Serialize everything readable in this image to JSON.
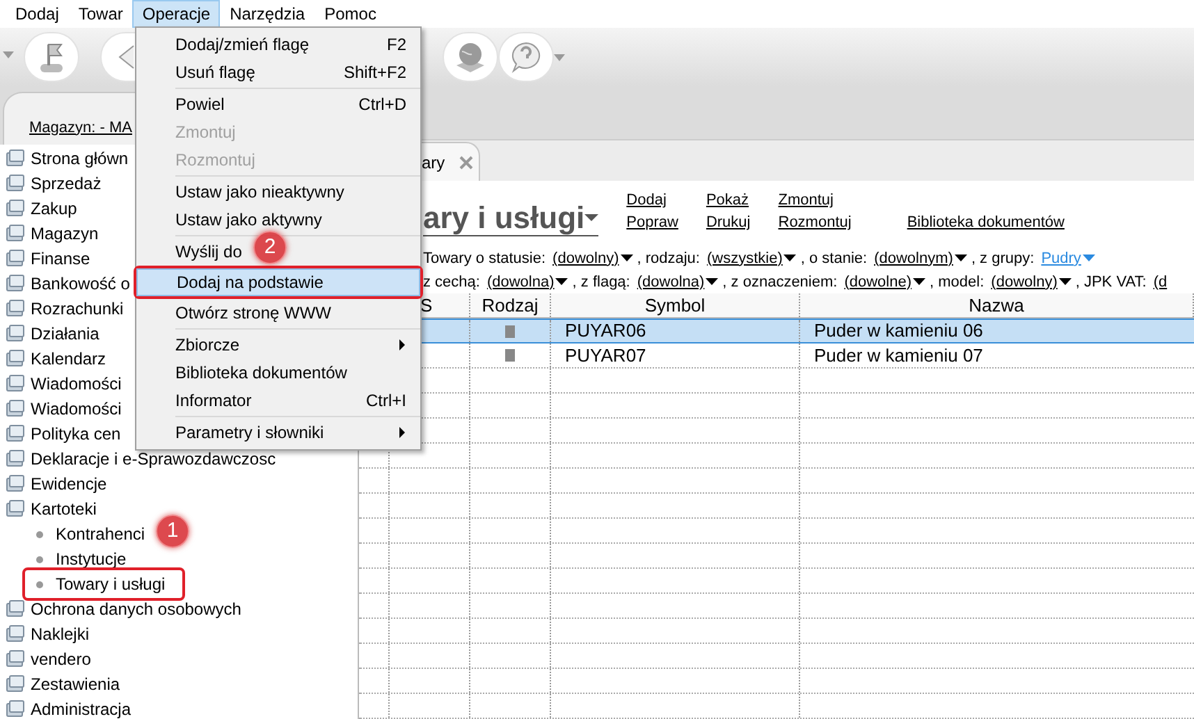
{
  "menu_bar": [
    {
      "label": "Dodaj",
      "selected": false
    },
    {
      "label": "Towar",
      "selected": false
    },
    {
      "label": "Operacje",
      "selected": true
    },
    {
      "label": "Narzędzia",
      "selected": false
    },
    {
      "label": "Pomoc",
      "selected": false
    }
  ],
  "dropdown_menu": [
    {
      "label": "Dodaj/zmień flagę",
      "shortcut": "F2",
      "disabled": false,
      "separator_after": false
    },
    {
      "label": "Usuń flagę",
      "shortcut": "Shift+F2",
      "disabled": false,
      "separator_after": true
    },
    {
      "label": "Powiel",
      "shortcut": "Ctrl+D",
      "disabled": false,
      "separator_after": false
    },
    {
      "label": "Zmontuj",
      "disabled": true,
      "separator_after": false
    },
    {
      "label": "Rozmontuj",
      "disabled": true,
      "separator_after": true
    },
    {
      "label": "Ustaw jako nieaktywny",
      "disabled": false,
      "separator_after": false
    },
    {
      "label": "Ustaw jako aktywny",
      "disabled": false,
      "separator_after": true
    },
    {
      "label": "Wyślij do",
      "disabled": false,
      "separator_after": false
    },
    {
      "label": "Dodaj na podstawie",
      "disabled": false,
      "selected": true,
      "highlighted": true,
      "separator_after": false
    },
    {
      "label": "Otwórz stronę WWW",
      "disabled": false,
      "separator_after": true
    },
    {
      "label": "Zbiorcze",
      "disabled": false,
      "submenu": true,
      "separator_after": false
    },
    {
      "label": "Biblioteka dokumentów",
      "disabled": false,
      "separator_after": false
    },
    {
      "label": "Informator",
      "shortcut": "Ctrl+I",
      "disabled": false,
      "separator_after": true
    },
    {
      "label": "Parametry i słowniki",
      "disabled": false,
      "submenu": true,
      "separator_after": false
    }
  ],
  "sidebar": {
    "header": "Magazyn: - MA",
    "items": [
      {
        "label": "Strona główn"
      },
      {
        "label": "Sprzedaż"
      },
      {
        "label": "Zakup"
      },
      {
        "label": "Magazyn"
      },
      {
        "label": "Finanse"
      },
      {
        "label": "Bankowość o"
      },
      {
        "label": "Rozrachunki"
      },
      {
        "label": "Działania"
      },
      {
        "label": "Kalendarz"
      },
      {
        "label": "Wiadomości"
      },
      {
        "label": "Wiadomości"
      },
      {
        "label": "Polityka cen"
      },
      {
        "label": "Deklaracje i e-Sprawozdawczosc"
      },
      {
        "label": "Ewidencje"
      },
      {
        "label": "Kartoteki",
        "children": [
          {
            "label": "Kontrahenci",
            "highlighted": false
          },
          {
            "label": "Instytucje",
            "highlighted": false
          },
          {
            "label": "Towary i usługi",
            "highlighted": true
          }
        ]
      },
      {
        "label": "Ochrona danych osobowych"
      },
      {
        "label": "Naklejki"
      },
      {
        "label": "vendero"
      },
      {
        "label": "Zestawienia"
      },
      {
        "label": "Administracja"
      }
    ]
  },
  "tab": {
    "label": "ary"
  },
  "page": {
    "title": "ary i usługi",
    "link_columns": [
      [
        "Dodaj",
        "Popraw"
      ],
      [
        "Pokaż",
        "Drukuj"
      ],
      [
        "Zmontuj",
        "Rozmontuj"
      ],
      [
        "",
        "Biblioteka dokumentów"
      ]
    ],
    "filter_rows": [
      [
        {
          "kind": "label",
          "text": "Towary o statusie:"
        },
        {
          "kind": "dropdown",
          "text": "(dowolny)",
          "active": false
        },
        {
          "kind": "label",
          "text": ", rodzaju:"
        },
        {
          "kind": "dropdown",
          "text": "(wszystkie)",
          "active": false
        },
        {
          "kind": "label",
          "text": ", o stanie:"
        },
        {
          "kind": "dropdown",
          "text": "(dowolnym)",
          "active": false
        },
        {
          "kind": "label",
          "text": ", z grupy:"
        },
        {
          "kind": "dropdown",
          "text": "Pudry",
          "active": true
        }
      ],
      [
        {
          "kind": "label",
          "text": "z cechą:"
        },
        {
          "kind": "dropdown",
          "text": "(dowolna)",
          "active": false
        },
        {
          "kind": "label",
          "text": ", z flagą:"
        },
        {
          "kind": "dropdown",
          "text": "(dowolna)",
          "active": false
        },
        {
          "kind": "label",
          "text": ", z oznaczeniem:"
        },
        {
          "kind": "dropdown",
          "text": "(dowolne)",
          "active": false
        },
        {
          "kind": "label",
          "text": ", model:"
        },
        {
          "kind": "dropdown",
          "text": "(dowolny)",
          "active": false
        },
        {
          "kind": "label",
          "text": ", JPK VAT:"
        },
        {
          "kind": "cut",
          "text": "(d"
        }
      ]
    ]
  },
  "table": {
    "columns": [
      "S",
      "Rodzaj",
      "Symbol",
      "Nazwa"
    ],
    "rows": [
      {
        "selected": true,
        "cells": [
          "PUYAR06",
          "Puder w kamieniu 06"
        ]
      },
      {
        "selected": false,
        "cells": [
          "PUYAR07",
          "Puder w kamieniu 07"
        ]
      }
    ]
  },
  "annotations": [
    {
      "label": "1"
    },
    {
      "label": "2"
    }
  ]
}
